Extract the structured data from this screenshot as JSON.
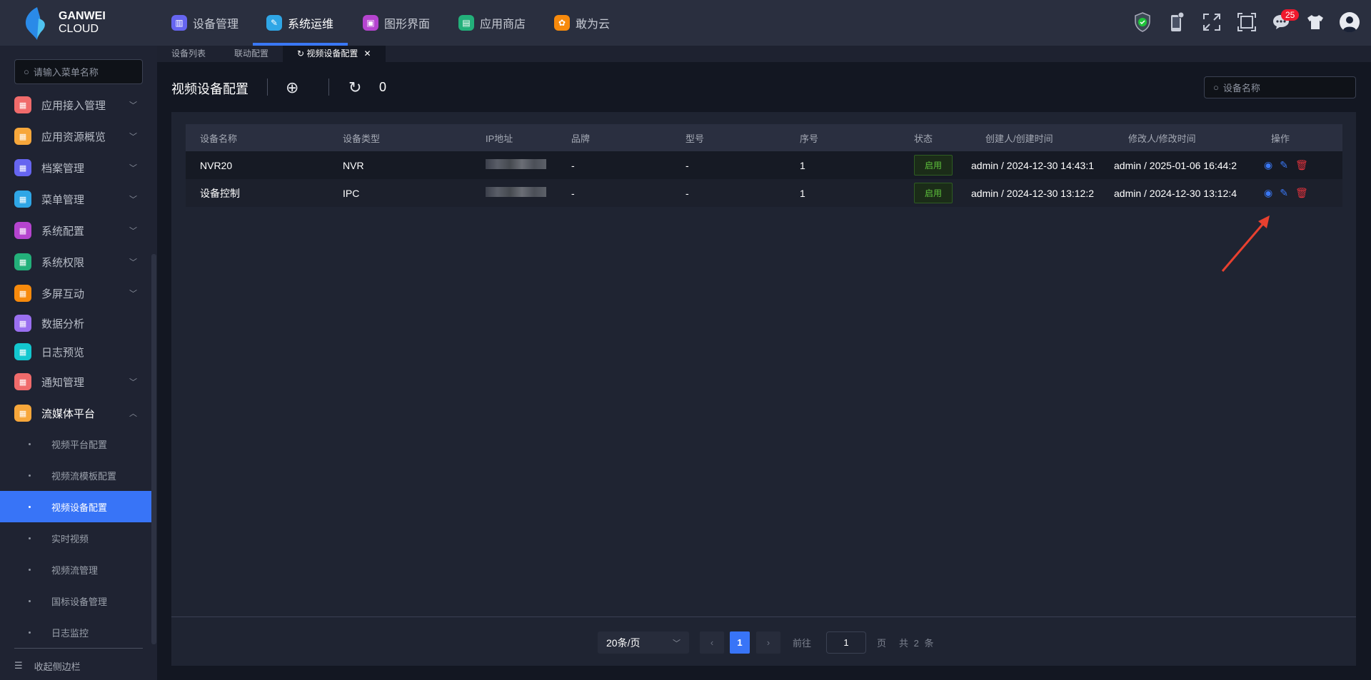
{
  "header": {
    "logo_line1": "GANWEI",
    "logo_line2": "CLOUD",
    "nav": [
      {
        "label": "设备管理",
        "color": "#6665f0",
        "active": false
      },
      {
        "label": "系统运维",
        "color": "#2fa6e6",
        "active": true
      },
      {
        "label": "图形界面",
        "color": "#b544cf",
        "active": false
      },
      {
        "label": "应用商店",
        "color": "#23b07a",
        "active": false
      },
      {
        "label": "敢为云",
        "color": "#f78a0c",
        "active": false
      }
    ],
    "notification_count": "25"
  },
  "tabs": [
    {
      "label": "设备列表"
    },
    {
      "label": "联动配置"
    },
    {
      "label": "视频设备配置",
      "active": true
    }
  ],
  "sidebar": {
    "search_placeholder": "请输入菜单名称",
    "items": [
      {
        "label": "应用接入管理",
        "color": "#f06b6b"
      },
      {
        "label": "应用资源概览",
        "color": "#f7a73b"
      },
      {
        "label": "档案管理",
        "color": "#6665f0"
      },
      {
        "label": "菜单管理",
        "color": "#2fa6e6"
      },
      {
        "label": "系统配置",
        "color": "#b544cf"
      },
      {
        "label": "系统权限",
        "color": "#23b07a"
      },
      {
        "label": "多屏互动",
        "color": "#f78a0c"
      },
      {
        "label": "数据分析",
        "color": "#9a6ff0"
      },
      {
        "label": "日志预览",
        "color": "#13c7cf"
      },
      {
        "label": "通知管理",
        "color": "#f06b6b"
      },
      {
        "label": "流媒体平台",
        "color": "#f7a73b"
      }
    ],
    "subitems": [
      {
        "label": "视频平台配置"
      },
      {
        "label": "视频流模板配置"
      },
      {
        "label": "视频设备配置",
        "active": true
      },
      {
        "label": "实时视频"
      },
      {
        "label": "视频流管理"
      },
      {
        "label": "国标设备管理"
      },
      {
        "label": "日志监控"
      }
    ],
    "collapse_label": "收起侧边栏"
  },
  "page": {
    "title": "视频设备配置",
    "refresh_count": "0",
    "search_placeholder": "设备名称"
  },
  "table": {
    "columns": [
      "设备名称",
      "设备类型",
      "IP地址",
      "品牌",
      "型号",
      "序号",
      "状态",
      "创建人/创建时间",
      "修改人/修改时间",
      "操作"
    ],
    "rows": [
      {
        "name": "NVR20",
        "type": "NVR",
        "brand": "-",
        "model": "-",
        "seq": "1",
        "status": "启用",
        "created": "admin / 2024-12-30 14:43:1",
        "modified": "admin / 2025-01-06 16:44:2"
      },
      {
        "name": "设备控制",
        "type": "IPC",
        "brand": "-",
        "model": "-",
        "seq": "1",
        "status": "启用",
        "created": "admin / 2024-12-30 13:12:2",
        "modified": "admin / 2024-12-30 13:12:4"
      }
    ]
  },
  "pagination": {
    "page_size": "20条/页",
    "current": "1",
    "goto_label": "前往",
    "goto_value": "1",
    "page_unit": "页",
    "total": "共 2 条"
  }
}
